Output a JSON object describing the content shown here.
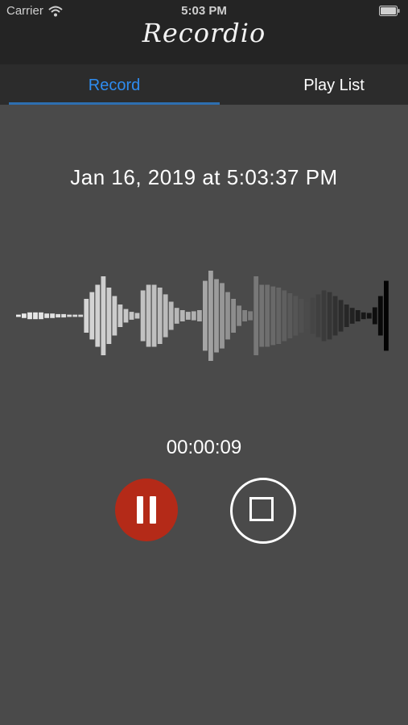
{
  "status_bar": {
    "carrier": "Carrier",
    "time": "5:03 PM",
    "wifi_icon": "wifi-icon",
    "battery_icon": "battery-icon"
  },
  "app": {
    "title": "Recordio"
  },
  "tabs": [
    {
      "label": "Record",
      "active": true
    },
    {
      "label": "Play List",
      "active": false
    }
  ],
  "recording": {
    "date": "Jan 16, 2019 at 5:03:37 PM",
    "elapsed": "00:00:09",
    "waveform_levels": [
      0.02,
      0.04,
      0.06,
      0.06,
      0.06,
      0.04,
      0.04,
      0.03,
      0.03,
      0.02,
      0.02,
      0.02,
      0.3,
      0.42,
      0.55,
      0.7,
      0.5,
      0.35,
      0.2,
      0.12,
      0.07,
      0.05,
      0.45,
      0.55,
      0.55,
      0.5,
      0.38,
      0.25,
      0.14,
      0.1,
      0.07,
      0.08,
      0.1,
      0.62,
      0.8,
      0.65,
      0.58,
      0.42,
      0.3,
      0.18,
      0.1,
      0.08,
      0.7,
      0.55,
      0.55,
      0.52,
      0.5,
      0.45,
      0.4,
      0.35,
      0.3,
      0.25,
      0.32,
      0.38,
      0.45,
      0.42,
      0.35,
      0.28,
      0.2,
      0.14,
      0.1,
      0.06,
      0.05,
      0.15,
      0.35,
      0.62
    ],
    "controls": {
      "pause_icon": "pause-icon",
      "stop_icon": "stop-icon"
    }
  },
  "colors": {
    "active_tab": "#2e8cf0",
    "pause_button": "#b42a18",
    "background": "#4a4a4a",
    "header": "#242424"
  }
}
